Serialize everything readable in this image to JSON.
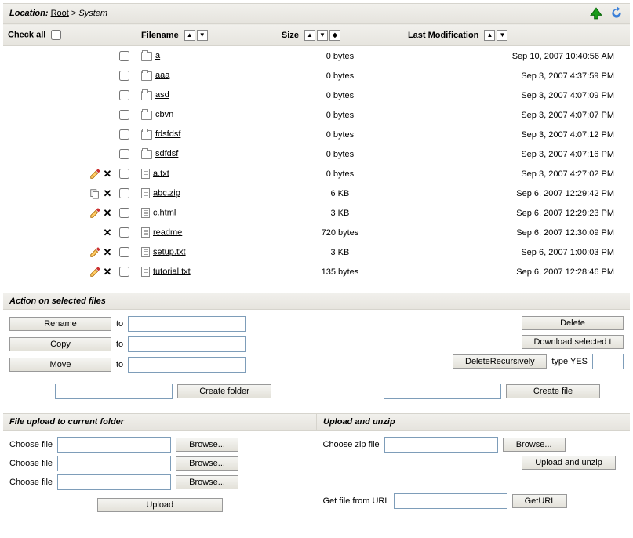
{
  "location": {
    "label": "Location:",
    "root": "Root",
    "sep": ">",
    "current": "System"
  },
  "header": {
    "check_all": "Check all",
    "filename": "Filename",
    "size": "Size",
    "last_mod": "Last Modification"
  },
  "files": [
    {
      "name": "a",
      "type": "folder",
      "size": "0 bytes",
      "mod": "Sep 10, 2007 10:40:56 AM",
      "edit": false,
      "copy": false,
      "del": false
    },
    {
      "name": "aaa",
      "type": "folder",
      "size": "0 bytes",
      "mod": "Sep 3, 2007 4:37:59 PM",
      "edit": false,
      "copy": false,
      "del": false
    },
    {
      "name": "asd",
      "type": "folder",
      "size": "0 bytes",
      "mod": "Sep 3, 2007 4:07:09 PM",
      "edit": false,
      "copy": false,
      "del": false
    },
    {
      "name": "cbvn",
      "type": "folder",
      "size": "0 bytes",
      "mod": "Sep 3, 2007 4:07:07 PM",
      "edit": false,
      "copy": false,
      "del": false
    },
    {
      "name": "fdsfdsf",
      "type": "folder",
      "size": "0 bytes",
      "mod": "Sep 3, 2007 4:07:12 PM",
      "edit": false,
      "copy": false,
      "del": false
    },
    {
      "name": "sdfdsf",
      "type": "folder",
      "size": "0 bytes",
      "mod": "Sep 3, 2007 4:07:16 PM",
      "edit": false,
      "copy": false,
      "del": false
    },
    {
      "name": "a.txt",
      "type": "file",
      "size": "0 bytes",
      "mod": "Sep 3, 2007 4:27:02 PM",
      "edit": true,
      "copy": false,
      "del": true
    },
    {
      "name": "abc.zip",
      "type": "file",
      "size": "6 KB",
      "mod": "Sep 6, 2007 12:29:42 PM",
      "edit": false,
      "copy": true,
      "del": true
    },
    {
      "name": "c.html",
      "type": "file",
      "size": "3 KB",
      "mod": "Sep 6, 2007 12:29:23 PM",
      "edit": true,
      "copy": false,
      "del": true
    },
    {
      "name": "readme",
      "type": "file",
      "size": "720 bytes",
      "mod": "Sep 6, 2007 12:30:09 PM",
      "edit": false,
      "copy": false,
      "del": true
    },
    {
      "name": "setup.txt",
      "type": "file",
      "size": "3 KB",
      "mod": "Sep 6, 2007 1:00:03 PM",
      "edit": true,
      "copy": false,
      "del": true
    },
    {
      "name": "tutorial.txt",
      "type": "file",
      "size": "135 bytes",
      "mod": "Sep 6, 2007 12:28:46 PM",
      "edit": true,
      "copy": false,
      "del": true
    }
  ],
  "actions": {
    "title": "Action on selected files",
    "rename": "Rename",
    "copy": "Copy",
    "move": "Move",
    "to": "to",
    "delete": "Delete",
    "download_selected": "Download selected t",
    "delete_recursively": "DeleteRecursively",
    "type_yes": "type YES",
    "create_folder": "Create folder",
    "create_file": "Create file"
  },
  "upload": {
    "title_left": "File upload to current folder",
    "title_right": "Upload and unzip",
    "choose_file": "Choose file",
    "browse": "Browse...",
    "upload": "Upload",
    "choose_zip": "Choose zip file",
    "upload_unzip": "Upload and unzip",
    "get_url_label": "Get file from URL",
    "get_url": "GetURL"
  }
}
